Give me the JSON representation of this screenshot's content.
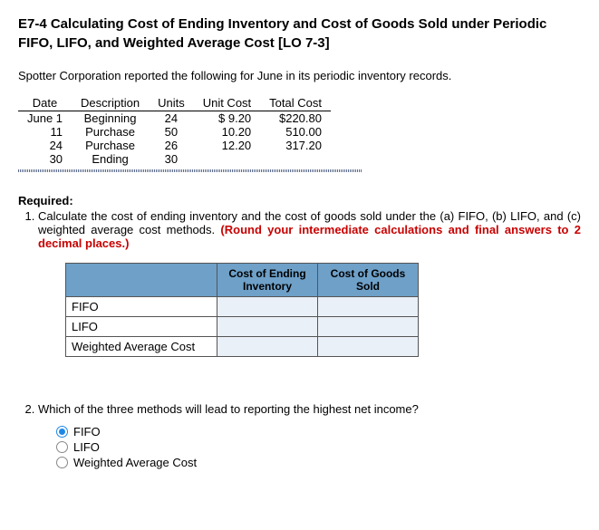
{
  "title": "E7-4 Calculating Cost of Ending Inventory and Cost of Goods Sold under Periodic FIFO, LIFO, and Weighted Average Cost [LO 7-3]",
  "intro": "Spotter Corporation reported the following for June in its periodic inventory records.",
  "inventory": {
    "headers": [
      "Date",
      "Description",
      "Units",
      "Unit Cost",
      "Total Cost"
    ],
    "rows": [
      {
        "date": "June  1",
        "desc": "Beginning",
        "units": "24",
        "unit_cost": "$  9.20",
        "total": "$220.80"
      },
      {
        "date": "11",
        "desc": "Purchase",
        "units": "50",
        "unit_cost": "10.20",
        "total": "510.00"
      },
      {
        "date": "24",
        "desc": "Purchase",
        "units": "26",
        "unit_cost": "12.20",
        "total": "317.20"
      },
      {
        "date": "30",
        "desc": "Ending",
        "units": "30",
        "unit_cost": "",
        "total": ""
      }
    ]
  },
  "required_label": "Required:",
  "q1": {
    "text": "Calculate the cost of ending inventory and the cost of goods sold under the (a) FIFO, (b) LIFO, and (c) weighted average cost methods. ",
    "red": "(Round your intermediate calculations and final answers to 2 decimal places.)",
    "col1": "Cost of Ending Inventory",
    "col2": "Cost of Goods Sold",
    "rows": [
      "FIFO",
      "LIFO",
      "Weighted Average Cost"
    ]
  },
  "q2": {
    "text": "Which of the three methods will lead to reporting the highest net income?",
    "options": [
      "FIFO",
      "LIFO",
      "Weighted Average Cost"
    ],
    "selected": 0
  }
}
